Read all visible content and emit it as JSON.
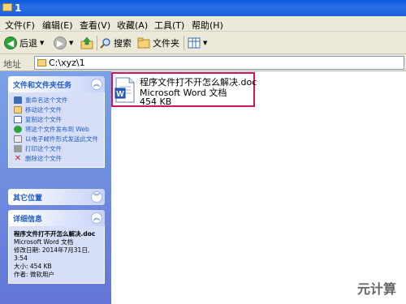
{
  "window": {
    "title": "1"
  },
  "menu": [
    "文件(F)",
    "编辑(E)",
    "查看(V)",
    "收藏(A)",
    "工具(T)",
    "帮助(H)"
  ],
  "toolbar": {
    "back_label": "后退",
    "search_label": "搜索",
    "folders_label": "文件夹"
  },
  "address": {
    "label": "地址",
    "path": "C:\\xyz\\1"
  },
  "file_tasks": {
    "title": "文件和文件夹任务",
    "items": [
      "重命名这个文件",
      "移动这个文件",
      "复制这个文件",
      "将这个文件发布到 Web",
      "以电子邮件形式发送此文件",
      "打印这个文件",
      "删除这个文件"
    ]
  },
  "other_places": {
    "title": "其它位置"
  },
  "details": {
    "title": "详细信息",
    "file_name": "程序文件打不开怎么解决.doc",
    "file_type": "Microsoft Word 文档",
    "modified": "修改日期: 2014年7月31日, 3:54",
    "size": "大小: 454 KB",
    "author": "作者: 微软用户"
  },
  "file": {
    "name": "程序文件打不开怎么解决.doc",
    "type": "Microsoft Word 文档",
    "size": "454 KB"
  },
  "watermark": "元计算",
  "colors": {
    "highlight_border": "#d0135c",
    "pane_gradient_top": "#7ba2e7",
    "link_text": "#215dc6"
  }
}
